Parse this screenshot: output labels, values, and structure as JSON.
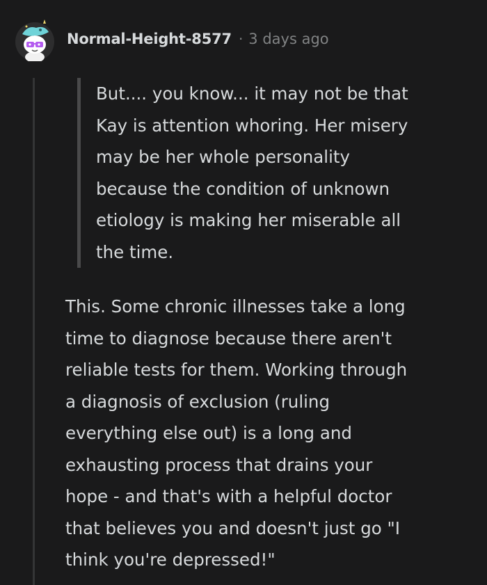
{
  "comment": {
    "username": "Normal-Height-8577",
    "separator": "·",
    "timestamp": "3 days ago",
    "quote_lines": [
      "But.... you know... it may not be that",
      "Kay is attention whoring. Her misery",
      "may be her whole personality",
      "because the condition of unknown",
      "etiology is making her miserable all",
      "the time."
    ],
    "body_lines": [
      "This. Some chronic illnesses take a long",
      "time to diagnose because there aren't",
      "reliable tests for them. Working through",
      "a diagnosis of exclusion (ruling",
      "everything else out) is a long and",
      "exhausting process that drains your",
      "hope - and that's with a helpful doctor",
      "that believes you and doesn't just go \"I",
      "think you're depressed!\""
    ]
  },
  "avatar": {
    "icon": "snoo-avatar-icon",
    "hat_color": "#6fd3d8",
    "glasses_color": "#b45cf0"
  },
  "colors": {
    "background": "#1a1a1b",
    "text": "#d7dadc",
    "meta": "#818384",
    "thread_line": "#343536",
    "quote_bar": "#4a4a4b"
  }
}
